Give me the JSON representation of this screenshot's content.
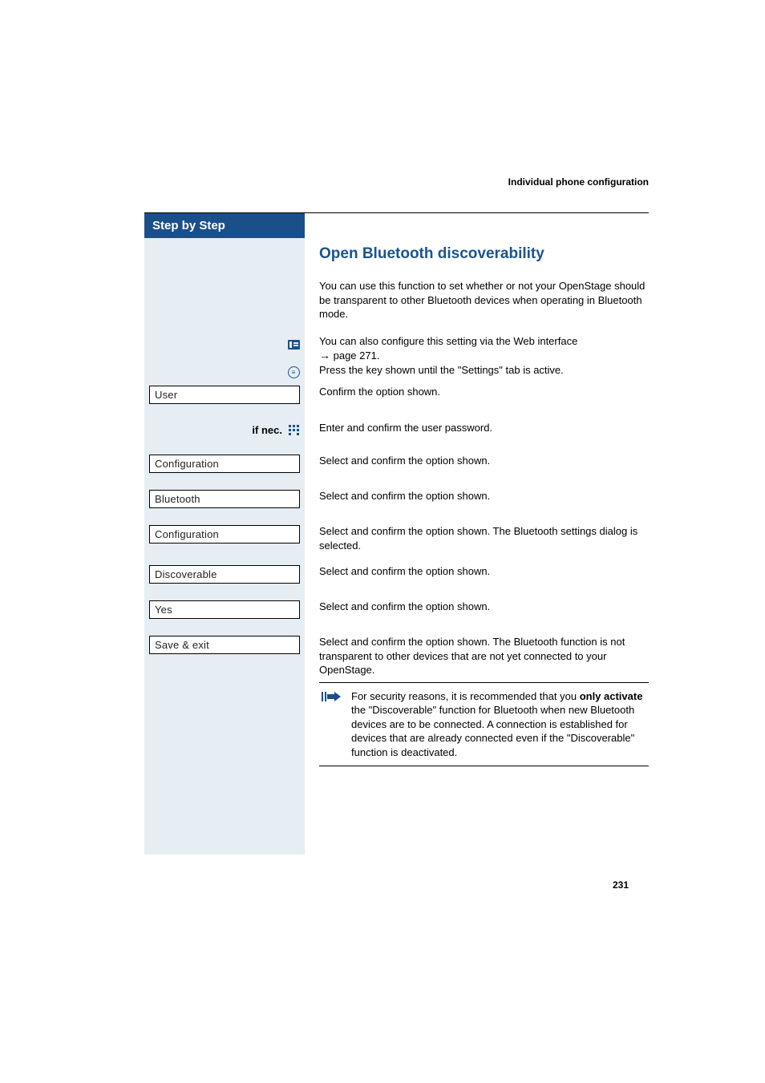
{
  "header": {
    "section_title": "Individual phone configuration"
  },
  "sidebar": {
    "header": "Step by Step",
    "if_nec_label": "if nec.",
    "menu_items": {
      "user": "User",
      "configuration1": "Configuration",
      "bluetooth": "Bluetooth",
      "configuration2": "Configuration",
      "discoverable": "Discoverable",
      "yes": "Yes",
      "save_exit": "Save & exit"
    }
  },
  "content": {
    "title": "Open Bluetooth discoverability",
    "intro": "You can use this function to set whether or not your OpenStage should be transparent to other Bluetooth devices when operating in Bluetooth mode.",
    "web_note_pre": "You can also configure this setting via the Web interface ",
    "web_note_arrow": "→",
    "web_note_post": " page 271.",
    "settings_key": "Press the key shown until the \"Settings\" tab is active.",
    "confirm_user": "Confirm the option shown.",
    "password": "Enter and confirm the user password.",
    "select_confirm": "Select and confirm the option shown.",
    "select_confirm_bt_dialog": "Select and confirm the option shown. The Bluetooth settings dialog is selected.",
    "select_confirm_save": "Select and confirm the option shown. The Bluetooth function is not transparent to other devices that are not yet connected to your OpenStage.",
    "security_note_pre": "For security reasons, it is recommended that you ",
    "security_note_bold": "only activate",
    "security_note_post": " the \"Discoverable\" function for Bluetooth when new Bluetooth devices are to be connected. A connection is established for devices that are already connected even if the \"Discoverable\" function is deactivated."
  },
  "page_number": "231"
}
